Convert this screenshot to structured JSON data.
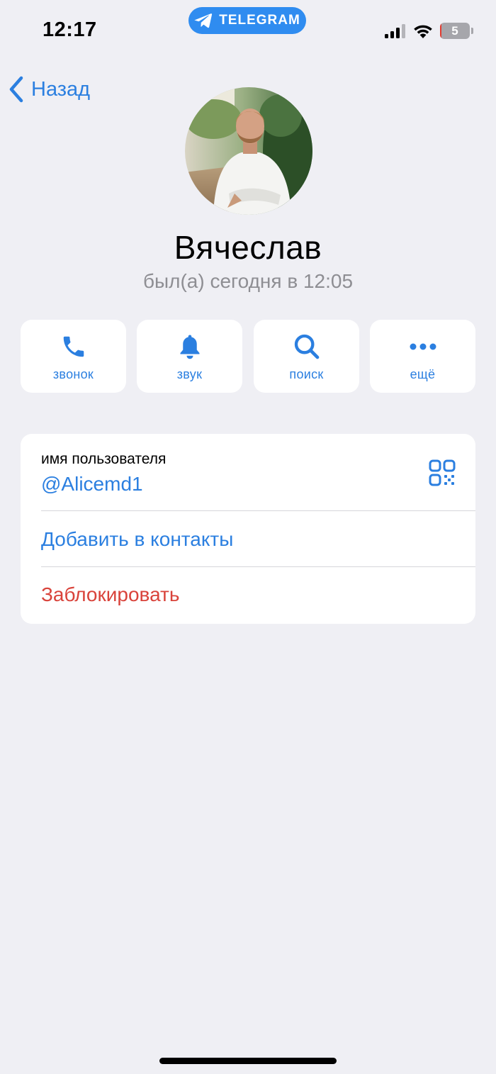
{
  "status_bar": {
    "time": "12:17",
    "app_name": "TELEGRAM",
    "battery_level": "5",
    "battery_fraction": 0.05
  },
  "nav": {
    "back_label": "Назад"
  },
  "profile": {
    "name": "Вячеслав",
    "status": "был(а) сегодня в 12:05"
  },
  "actions": [
    {
      "label": "звонок",
      "icon": "phone-icon"
    },
    {
      "label": "звук",
      "icon": "bell-icon"
    },
    {
      "label": "поиск",
      "icon": "search-icon"
    },
    {
      "label": "ещё",
      "icon": "more-icon"
    }
  ],
  "info": {
    "username_caption": "имя пользователя",
    "username": "@Alicemd1",
    "add_contact": "Добавить в контакты",
    "block": "Заблокировать"
  },
  "colors": {
    "accent": "#2b7fe0",
    "destructive": "#d9433b",
    "background": "#efeff4",
    "secondary_text": "#8e8e93"
  }
}
